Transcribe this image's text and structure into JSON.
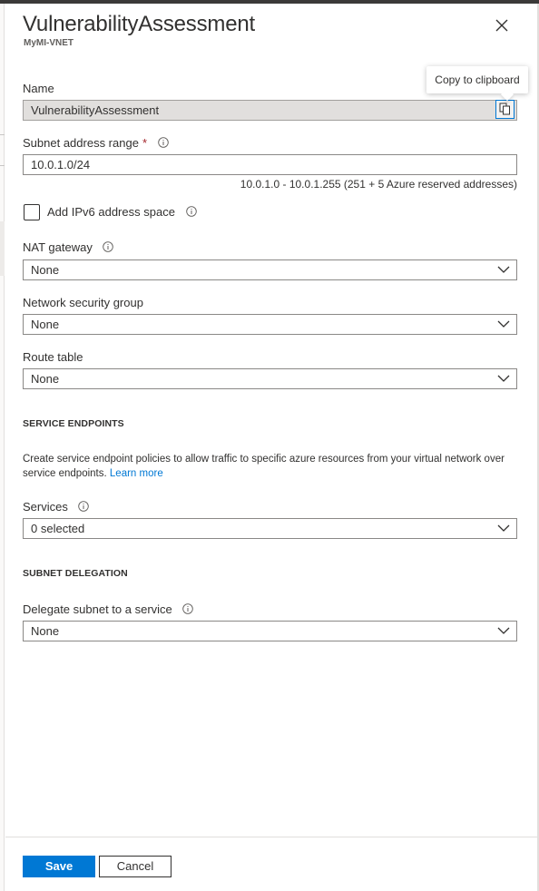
{
  "panel": {
    "title": "VulnerabilityAssessment",
    "subtitle": "MyMI-VNET"
  },
  "tooltip": {
    "text": "Copy to clipboard"
  },
  "name_field": {
    "label": "Name",
    "value": "VulnerabilityAssessment"
  },
  "subnet_range": {
    "label": "Subnet address range",
    "required_mark": "*",
    "value": "10.0.1.0/24",
    "helper": "10.0.1.0 - 10.0.1.255 (251 + 5 Azure reserved addresses)"
  },
  "ipv6": {
    "label": "Add IPv6 address space",
    "checked": false
  },
  "nat_gateway": {
    "label": "NAT gateway",
    "value": "None"
  },
  "nsg": {
    "label": "Network security group",
    "value": "None"
  },
  "route_table": {
    "label": "Route table",
    "value": "None"
  },
  "service_endpoints": {
    "heading": "SERVICE ENDPOINTS",
    "description": "Create service endpoint policies to allow traffic to specific azure resources from your virtual network over service endpoints.",
    "learn_more": "Learn more",
    "services_label": "Services",
    "services_value": "0 selected"
  },
  "delegation": {
    "heading": "SUBNET DELEGATION",
    "label": "Delegate subnet to a service",
    "value": "None"
  },
  "footer": {
    "save_label": "Save",
    "cancel_label": "Cancel"
  },
  "colors": {
    "accent": "#0078d4",
    "required": "#a4262c",
    "text": "#323130"
  }
}
